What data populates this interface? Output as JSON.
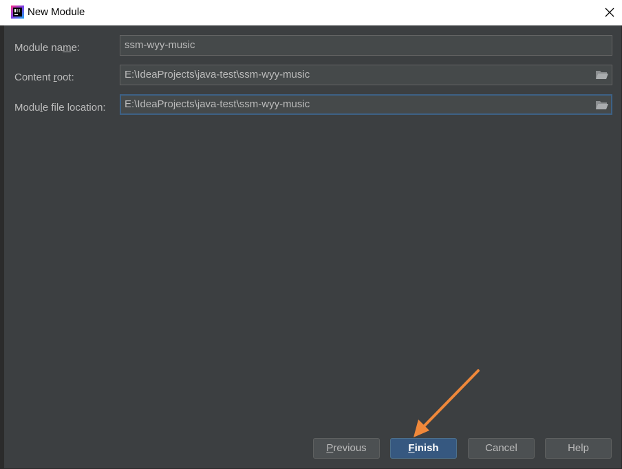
{
  "window": {
    "title": "New Module",
    "icon": "intellij-idea-icon"
  },
  "form": {
    "module_name": {
      "label_pre": "Module na",
      "label_mnemonic": "m",
      "label_post": "e:",
      "value": "ssm-wyy-music"
    },
    "content_root": {
      "label_pre": "Content ",
      "label_mnemonic": "r",
      "label_post": "oot:",
      "value": "E:\\IdeaProjects\\java-test\\ssm-wyy-music"
    },
    "module_file_location": {
      "label_pre": "Modu",
      "label_mnemonic": "l",
      "label_post": "e file location:",
      "value": "E:\\IdeaProjects\\java-test\\ssm-wyy-music"
    }
  },
  "buttons": {
    "previous": {
      "mnemonic": "P",
      "rest": "revious"
    },
    "finish": {
      "mnemonic": "F",
      "rest": "inish"
    },
    "cancel": {
      "label": "Cancel"
    },
    "help": {
      "label": "Help"
    }
  },
  "colors": {
    "background": "#3c3f41",
    "field_bg": "#45494a",
    "text": "#bbbbbb",
    "default_button": "#365880",
    "focus_border": "#3d6185",
    "annotation_arrow": "#f0883a"
  }
}
